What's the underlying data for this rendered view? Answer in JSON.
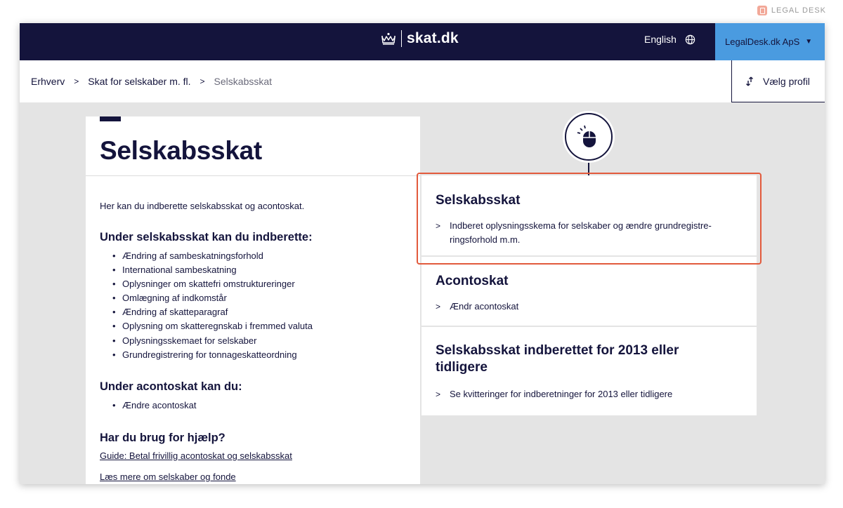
{
  "watermark": {
    "label": "LEGAL DESK"
  },
  "header": {
    "brand": "skat.dk",
    "language": "English",
    "account": "LegalDesk.dk ApS"
  },
  "breadcrumb": {
    "items": [
      "Erhverv",
      "Skat for selskaber m. fl.",
      "Selskabsskat"
    ]
  },
  "profile_button": "Vælg profil",
  "page": {
    "title": "Selskabsskat",
    "intro": "Her kan du indberette selskabsskat og acontoskat.",
    "section1": {
      "heading": "Under selskabsskat kan du indberette:",
      "items": [
        "Ændring af sambeskatningsforhold",
        "International sambeskatning",
        "Oplysninger om skattefri omstruktureringer",
        "Omlægning af indkomstår",
        "Ændring af skatteparagraf",
        "Oplysning om skatteregnskab i fremmed valuta",
        "Oplysningsskemaet for selskaber",
        "Grundregistrering for tonnageskatteordning"
      ]
    },
    "section2": {
      "heading": "Under acontoskat kan du:",
      "items": [
        "Ændre acontoskat"
      ]
    },
    "help": {
      "heading": "Har du brug for hjælp?",
      "links": [
        "Guide: Betal frivillig acontoskat og selskabsskat",
        "Læs mere om selskaber og fonde"
      ]
    }
  },
  "cards": [
    {
      "heading": "Selskabsskat",
      "link_line1": "Indberet oplysningsskema for selskaber og ændre grundregistre-",
      "link_line2": "ringsforhold m.m."
    },
    {
      "heading": "Acontoskat",
      "link": "Ændr acontoskat"
    },
    {
      "heading_line1": "Selskabsskat indberettet for 2013 eller",
      "heading_line2": "tidligere",
      "link": "Se kvitteringer for indberetninger for 2013 eller tidligere"
    }
  ],
  "colors": {
    "navy": "#14143c",
    "accent_blue": "#4a9be0",
    "highlight": "#e25a3c",
    "background": "#e4e4e4"
  }
}
